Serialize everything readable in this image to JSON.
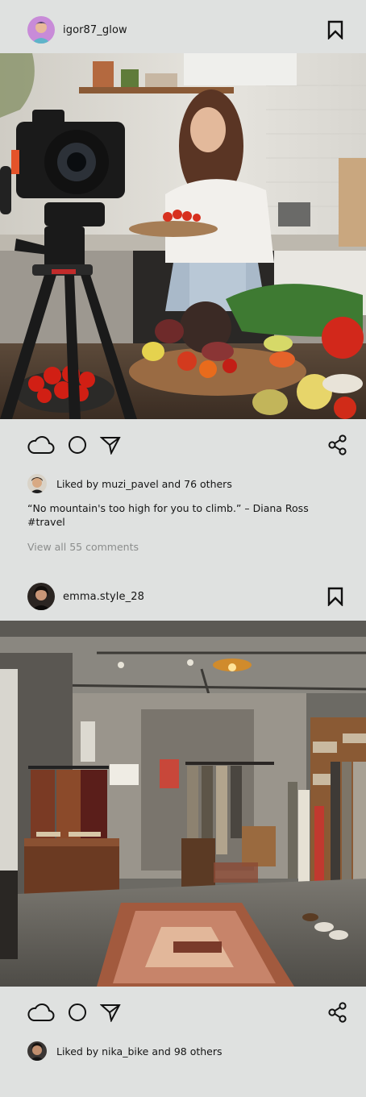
{
  "posts": [
    {
      "username": "igor87_glow",
      "avatar_icon": "user-avatar-pink",
      "liked_by": "Liked by muzi_pavel and 76 others",
      "caption_quote": "“No mountain's too high for you to climb.” – Diana Ross",
      "caption_tag": "#travel",
      "comments": "View all 55 comments"
    },
    {
      "username": "emma.style_28",
      "avatar_icon": "user-avatar-dark",
      "liked_by": "Liked by nika_bike and 98 others"
    }
  ],
  "icons": [
    "bookmark-icon",
    "heart-cloud-icon",
    "comment-icon",
    "send-icon",
    "share-icon"
  ],
  "colors": {
    "background": "#dfe1e0",
    "muted_text": "#8b8d8c",
    "text": "#151515"
  }
}
